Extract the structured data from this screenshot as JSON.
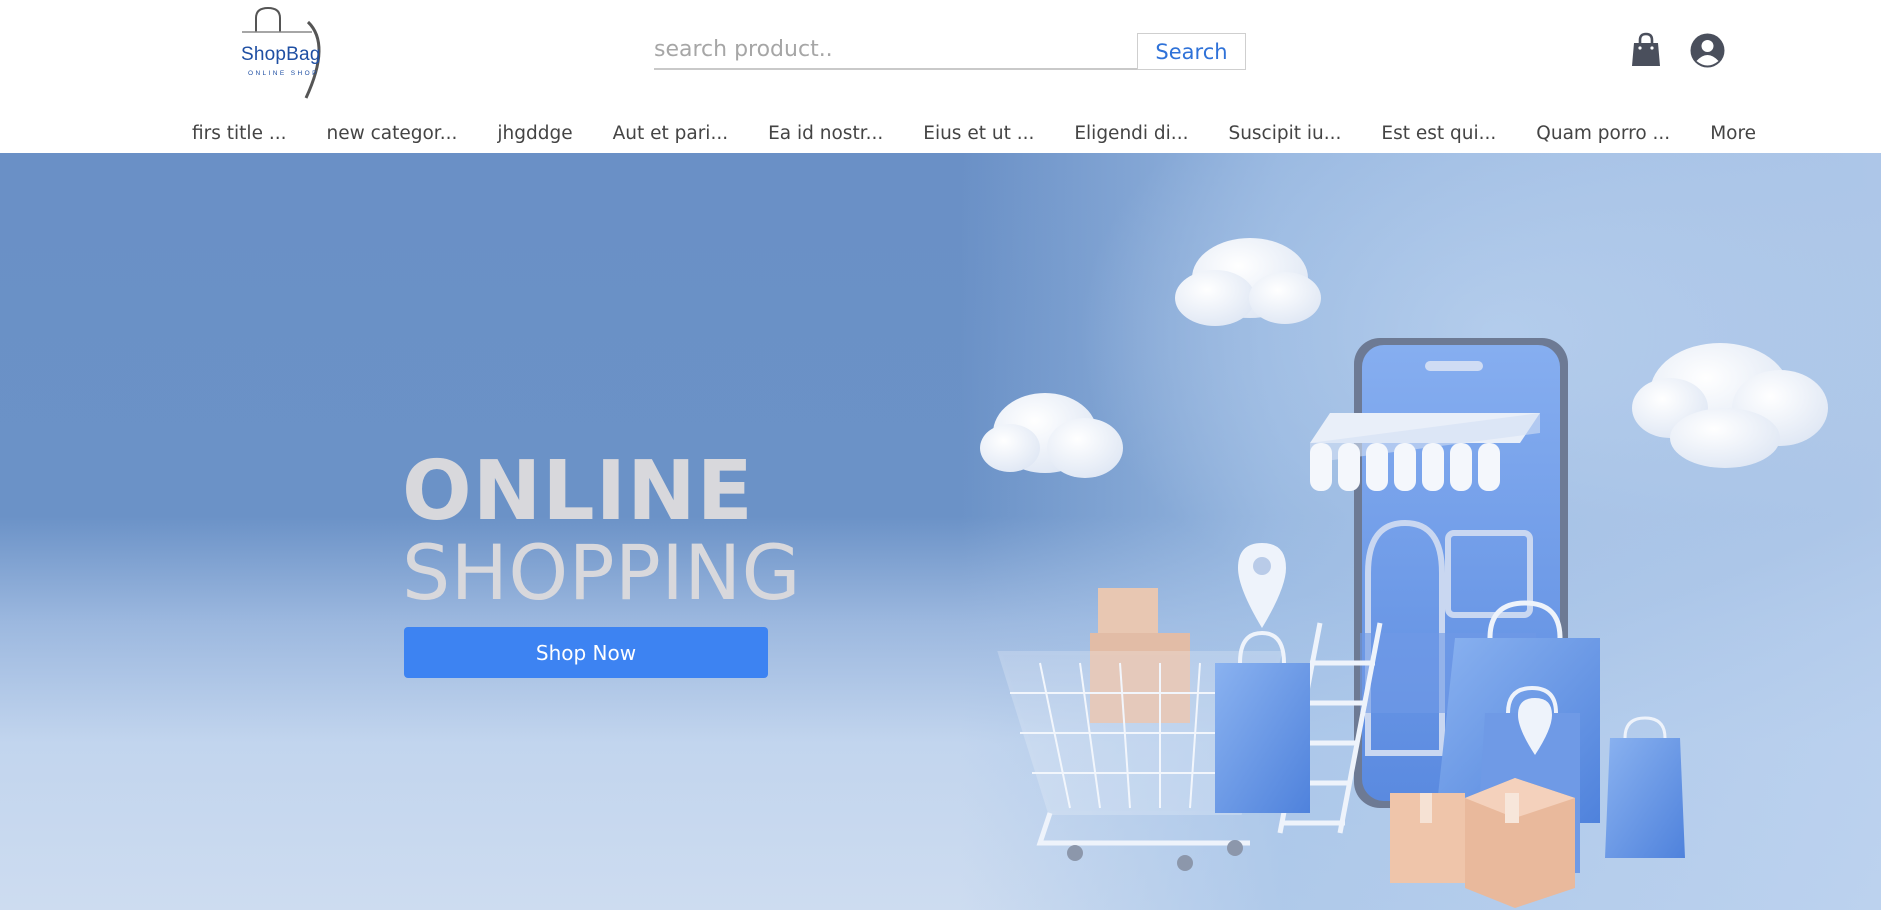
{
  "header": {
    "logo": {
      "name": "ShopBag",
      "tagline": "ONLINE SHOP"
    },
    "search": {
      "placeholder": "search product..",
      "value": "",
      "button_label": "Search"
    },
    "icons": {
      "cart": "shopping-bag-icon",
      "account": "user-circle-icon"
    }
  },
  "nav": {
    "items": [
      {
        "label": "firs title ..."
      },
      {
        "label": "new categor..."
      },
      {
        "label": "jhgddge"
      },
      {
        "label": "Aut et pari..."
      },
      {
        "label": "Ea id nostr..."
      },
      {
        "label": "Eius et ut ..."
      },
      {
        "label": "Eligendi di..."
      },
      {
        "label": "Suscipit iu..."
      },
      {
        "label": "Est est qui..."
      },
      {
        "label": "Quam porro ..."
      },
      {
        "label": "More"
      }
    ]
  },
  "hero": {
    "title_line1": "ONLINE",
    "title_line2": "SHOPPING",
    "cta_label": "Shop Now"
  },
  "colors": {
    "brand": "#1f4fa3",
    "accent": "#3d83f2",
    "search_text": "#2f72d8",
    "hero_bg": "#6a90c6",
    "icon_dark": "#4a4f5c"
  }
}
